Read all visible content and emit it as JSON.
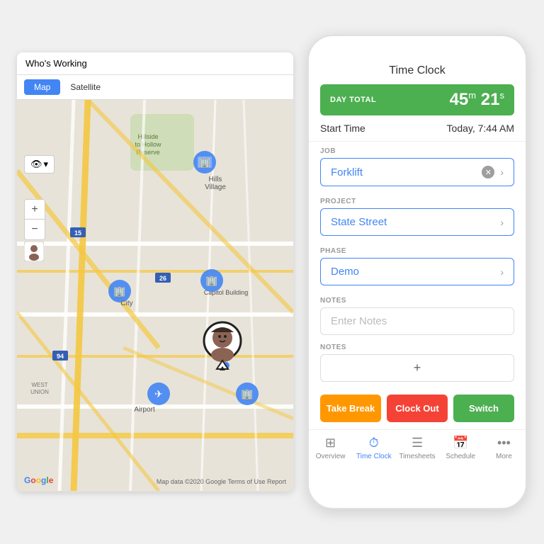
{
  "map": {
    "title": "Who's Working",
    "tab_map": "Map",
    "tab_satellite": "Satellite",
    "zoom_plus": "+",
    "zoom_minus": "−",
    "google_logo": "Google",
    "footer_text": "Map data ©2020 Google  Terms of Use  Report"
  },
  "phone": {
    "title": "Time Clock",
    "day_total_label": "DAY TOTAL",
    "day_total_minutes": "45",
    "day_total_seconds": "21",
    "start_time_label": "Start Time",
    "start_time_value": "Today, 7:44 AM",
    "job_label": "JOB",
    "job_value": "Forklift",
    "project_label": "PROJECT",
    "project_value": "State Street",
    "phase_label": "PHASE",
    "phase_value": "Demo",
    "notes_label": "NOTES",
    "notes_placeholder": "Enter Notes",
    "notes2_label": "NOTES",
    "btn_break": "Take Break",
    "btn_clockout": "Clock Out",
    "btn_switch": "Switch",
    "nav": [
      {
        "icon": "⊞",
        "label": "Overview"
      },
      {
        "icon": "⏱",
        "label": "Time Clock"
      },
      {
        "icon": "≡",
        "label": "Timesheets"
      },
      {
        "icon": "📅",
        "label": "Schedule"
      },
      {
        "icon": "•••",
        "label": "More"
      }
    ]
  }
}
